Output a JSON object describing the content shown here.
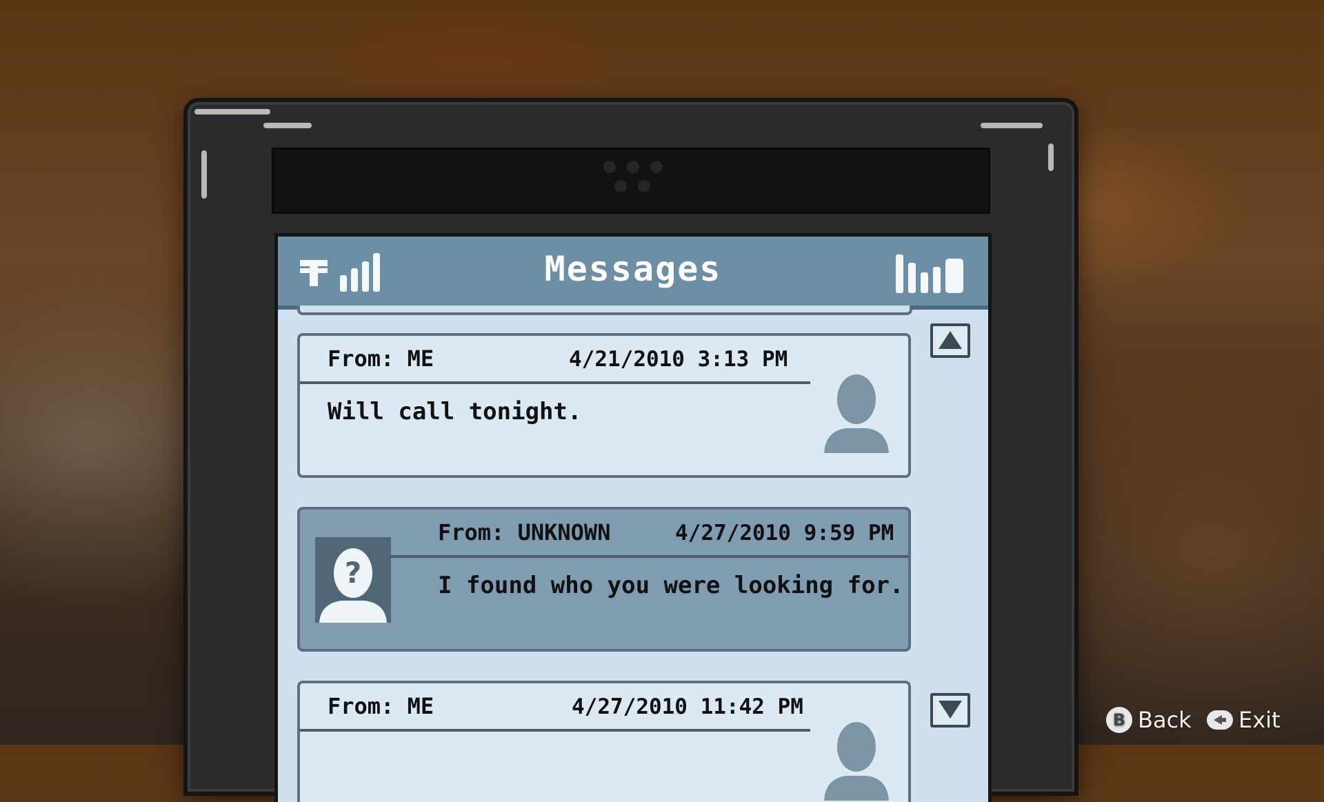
{
  "phone": {
    "title": "Messages",
    "icons": {
      "carrier": "carrier-t-icon",
      "signal": "signal-strength-icon",
      "battery": "battery-icon"
    },
    "messages": [
      {
        "from": "From: ME",
        "date": "4/21/2010 3:13 PM",
        "text": "Will call tonight.",
        "type": "outgoing",
        "avatar": "person-silhouette-icon"
      },
      {
        "from": "From: UNKNOWN",
        "date": "4/27/2010 9:59 PM",
        "text": "I found who you were looking for.",
        "type": "incoming",
        "avatar": "unknown-person-icon"
      },
      {
        "from": "From: ME",
        "date": "4/27/2010 11:42 PM",
        "text": "",
        "type": "outgoing",
        "avatar": "person-silhouette-icon"
      }
    ]
  },
  "controls": {
    "back_button_glyph": "B",
    "back_label": "Back",
    "exit_label": "Exit"
  },
  "colors": {
    "header": "#6d8fa6",
    "screen": "#cfe1ee",
    "incoming_card": "#7f9cb1"
  }
}
